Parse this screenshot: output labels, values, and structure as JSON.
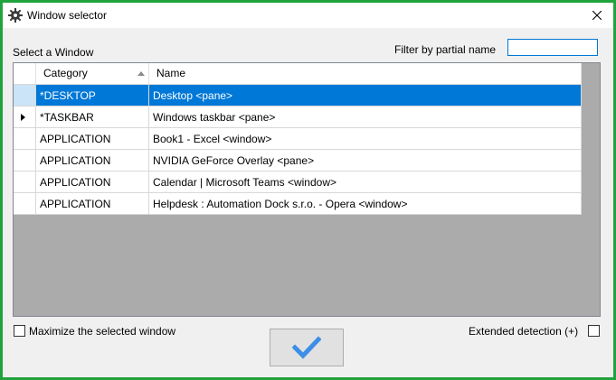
{
  "window": {
    "title": "Window selector",
    "icon": "gear-icon",
    "close_icon": "close-icon"
  },
  "labels": {
    "select_window": "Select a Window",
    "filter": "Filter by partial name"
  },
  "filter_input": {
    "value": "",
    "placeholder": ""
  },
  "grid": {
    "columns": [
      "Category",
      "Name"
    ],
    "sort": {
      "column": "Category",
      "direction": "ascending"
    },
    "selected_row": 0,
    "current_row": 1,
    "rows": [
      {
        "category": "*DESKTOP",
        "name": "Desktop <pane>"
      },
      {
        "category": "*TASKBAR",
        "name": "Windows taskbar <pane>"
      },
      {
        "category": "APPLICATION",
        "name": "Book1 - Excel <window>"
      },
      {
        "category": "APPLICATION",
        "name": "NVIDIA GeForce Overlay <pane>"
      },
      {
        "category": "APPLICATION",
        "name": "Calendar | Microsoft Teams <window>"
      },
      {
        "category": "APPLICATION",
        "name": "Helpdesk : Automation Dock s.r.o. - Opera <window>"
      }
    ]
  },
  "options": {
    "maximize": {
      "label": "Maximize the selected window",
      "checked": false
    },
    "extended": {
      "label": "Extended detection (+)",
      "checked": false
    }
  },
  "ok_button": {
    "icon": "checkmark-icon"
  },
  "colors": {
    "border_green": "#1fa33c",
    "selection": "#0078d7",
    "checkmark": "#3c8ee6"
  }
}
